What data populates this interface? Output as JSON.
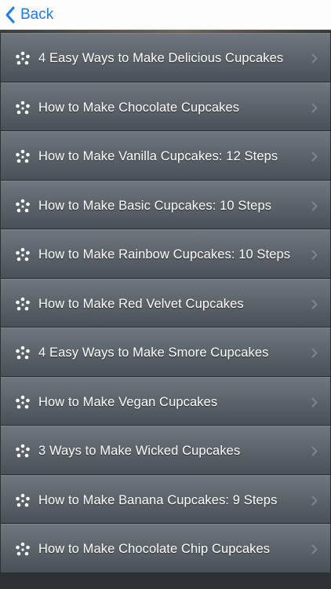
{
  "nav": {
    "back_label": "Back"
  },
  "colors": {
    "accent": "#1a7cf2",
    "row_text": "#ffffff"
  },
  "icons": {
    "back": "chevron-left-icon",
    "item": "sparkle-dots-icon",
    "disclosure": "chevron-right-icon"
  },
  "list": {
    "items": [
      {
        "label": "4 Easy Ways to Make Delicious Cupcakes"
      },
      {
        "label": "How to Make Chocolate Cupcakes"
      },
      {
        "label": "How to Make Vanilla Cupcakes: 12 Steps"
      },
      {
        "label": "How to Make Basic Cupcakes: 10 Steps"
      },
      {
        "label": "How to Make Rainbow Cupcakes: 10 Steps"
      },
      {
        "label": "How to Make Red Velvet Cupcakes"
      },
      {
        "label": "4 Easy Ways to Make Smore Cupcakes"
      },
      {
        "label": "How to Make Vegan Cupcakes"
      },
      {
        "label": "3 Ways to Make Wicked Cupcakes"
      },
      {
        "label": "How to Make Banana Cupcakes: 9 Steps"
      },
      {
        "label": "How to Make Chocolate Chip Cupcakes"
      }
    ]
  }
}
